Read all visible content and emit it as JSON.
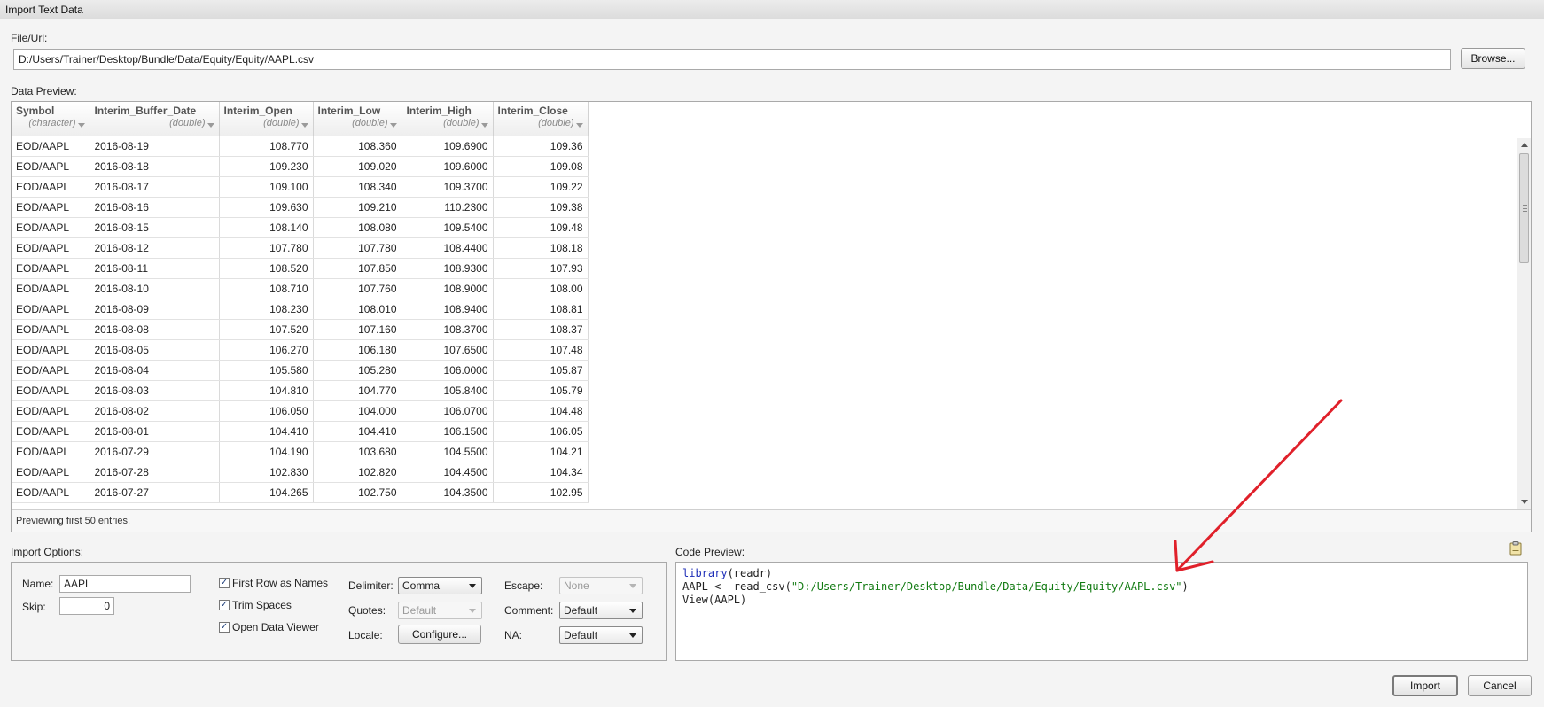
{
  "window": {
    "title": "Import Text Data"
  },
  "file": {
    "label": "File/Url:",
    "value": "D:/Users/Trainer/Desktop/Bundle/Data/Equity/Equity/AAPL.csv",
    "browse_label": "Browse..."
  },
  "preview": {
    "label": "Data Preview:",
    "columns": [
      {
        "name": "Symbol",
        "type": "(character)"
      },
      {
        "name": "Interim_Buffer_Date",
        "type": "(double)"
      },
      {
        "name": "Interim_Open",
        "type": "(double)"
      },
      {
        "name": "Interim_Low",
        "type": "(double)"
      },
      {
        "name": "Interim_High",
        "type": "(double)"
      },
      {
        "name": "Interim_Close",
        "type": "(double)"
      }
    ],
    "rows": [
      [
        "EOD/AAPL",
        "2016-08-19",
        "108.770",
        "108.360",
        "109.6900",
        "109.36"
      ],
      [
        "EOD/AAPL",
        "2016-08-18",
        "109.230",
        "109.020",
        "109.6000",
        "109.08"
      ],
      [
        "EOD/AAPL",
        "2016-08-17",
        "109.100",
        "108.340",
        "109.3700",
        "109.22"
      ],
      [
        "EOD/AAPL",
        "2016-08-16",
        "109.630",
        "109.210",
        "110.2300",
        "109.38"
      ],
      [
        "EOD/AAPL",
        "2016-08-15",
        "108.140",
        "108.080",
        "109.5400",
        "109.48"
      ],
      [
        "EOD/AAPL",
        "2016-08-12",
        "107.780",
        "107.780",
        "108.4400",
        "108.18"
      ],
      [
        "EOD/AAPL",
        "2016-08-11",
        "108.520",
        "107.850",
        "108.9300",
        "107.93"
      ],
      [
        "EOD/AAPL",
        "2016-08-10",
        "108.710",
        "107.760",
        "108.9000",
        "108.00"
      ],
      [
        "EOD/AAPL",
        "2016-08-09",
        "108.230",
        "108.010",
        "108.9400",
        "108.81"
      ],
      [
        "EOD/AAPL",
        "2016-08-08",
        "107.520",
        "107.160",
        "108.3700",
        "108.37"
      ],
      [
        "EOD/AAPL",
        "2016-08-05",
        "106.270",
        "106.180",
        "107.6500",
        "107.48"
      ],
      [
        "EOD/AAPL",
        "2016-08-04",
        "105.580",
        "105.280",
        "106.0000",
        "105.87"
      ],
      [
        "EOD/AAPL",
        "2016-08-03",
        "104.810",
        "104.770",
        "105.8400",
        "105.79"
      ],
      [
        "EOD/AAPL",
        "2016-08-02",
        "106.050",
        "104.000",
        "106.0700",
        "104.48"
      ],
      [
        "EOD/AAPL",
        "2016-08-01",
        "104.410",
        "104.410",
        "106.1500",
        "106.05"
      ],
      [
        "EOD/AAPL",
        "2016-07-29",
        "104.190",
        "103.680",
        "104.5500",
        "104.21"
      ],
      [
        "EOD/AAPL",
        "2016-07-28",
        "102.830",
        "102.820",
        "104.4500",
        "104.34"
      ],
      [
        "EOD/AAPL",
        "2016-07-27",
        "104.265",
        "102.750",
        "104.3500",
        "102.95"
      ]
    ],
    "status": "Previewing first 50 entries."
  },
  "import_options": {
    "label": "Import Options:",
    "name_label": "Name:",
    "name_value": "AAPL",
    "skip_label": "Skip:",
    "skip_value": "0",
    "first_row_names": "First Row as Names",
    "trim_spaces": "Trim Spaces",
    "open_viewer": "Open Data Viewer",
    "check_mark": "✓",
    "delimiter_label": "Delimiter:",
    "delimiter_value": "Comma",
    "quotes_label": "Quotes:",
    "quotes_value": "Default",
    "locale_label": "Locale:",
    "configure_label": "Configure...",
    "escape_label": "Escape:",
    "escape_value": "None",
    "comment_label": "Comment:",
    "comment_value": "Default",
    "na_label": "NA:",
    "na_value": "Default"
  },
  "code_preview": {
    "label": "Code Preview:",
    "line1_fn": "library",
    "line1_rest": "(readr)",
    "line2_pre": "AAPL <- read_csv(",
    "line2_str": "\"D:/Users/Trainer/Desktop/Bundle/Data/Equity/Equity/AAPL.csv\"",
    "line2_post": ")",
    "line3": "View(AAPL)"
  },
  "actions": {
    "import_label": "Import",
    "cancel_label": "Cancel"
  },
  "colors": {
    "annotation_arrow": "#e0202a",
    "code_string": "#117a11",
    "code_keyword": "#1f2fb8"
  }
}
